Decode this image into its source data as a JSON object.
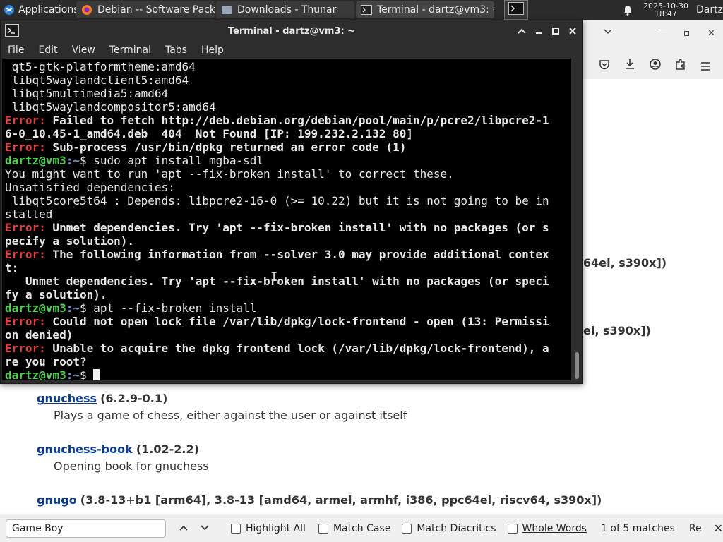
{
  "taskbar": {
    "apps_label": "Applications",
    "tasks": [
      {
        "label": "Debian -- Software Pack..."
      },
      {
        "label": "Downloads - Thunar"
      },
      {
        "label": "Terminal - dartz@vm3: ~"
      }
    ],
    "date": "2025-10-30",
    "time": "18:47",
    "user": "Dartz"
  },
  "terminal": {
    "title": "Terminal - dartz@vm3: ~",
    "menu": [
      "File",
      "Edit",
      "View",
      "Terminal",
      "Tabs",
      "Help"
    ],
    "prompt_user": "dartz@vm3",
    "prompt_path": ":~",
    "prompt_sign": "$",
    "error_tag": "Error:",
    "lines": {
      "l1": " qt5-gtk-platformtheme:amd64",
      "l2": " libqt5waylandclient5:amd64",
      "l3": " libqt5multimedia5:amd64",
      "l4": " libqt5waylandcompositor5:amd64",
      "l5": " Failed to fetch http://deb.debian.org/debian/pool/main/p/pcre2/libpcre2-1",
      "l6": "6-0_10.45-1_amd64.deb  404  Not Found [IP: 199.232.2.132 80]",
      "l7": " Sub-process /usr/bin/dpkg returned an error code (1)",
      "l8": " sudo apt install mgba-sdl",
      "l9": "You might want to run 'apt --fix-broken install' to correct these.",
      "l10": "Unsatisfied dependencies:",
      "l11": " libqt5core5t64 : Depends: libpcre2-16-0 (>= 10.22) but it is not going to be in",
      "l12": "stalled",
      "l13": " Unmet dependencies. Try 'apt --fix-broken install' with no packages (or s",
      "l14": "pecify a solution).",
      "l15": " The following information from --solver 3.0 may provide additional contex",
      "l16": "t:",
      "l17": "   Unmet dependencies. Try 'apt --fix-broken install' with no packages (or speci",
      "l18": "fy a solution).",
      "l19": " apt --fix-broken install",
      "l20": " Could not open lock file /var/lib/dpkg/lock-frontend - open (13: Permissi",
      "l21": "on denied)",
      "l22": " Unable to acquire the dpkg frontend lock (/var/lib/dpkg/lock-frontend), a",
      "l23": "re you root?",
      "l24": " "
    }
  },
  "browser": {
    "frag1": "64el, s390x])",
    "frag2": "el, s390x])",
    "packages": [
      {
        "name": "gnuchess",
        "version": "(6.2.9-0.1)",
        "desc": "Plays a game of chess, either against the user or against itself"
      },
      {
        "name": "gnuchess-book",
        "version": "(1.02-2.2)",
        "desc": "Opening book for gnuchess"
      },
      {
        "name": "gnugo",
        "version": "(3.8-13+b1 [arm64], 3.8-13 [amd64, armel, armhf, i386, ppc64el, riscv64, s390x])",
        "desc": ""
      }
    ]
  },
  "findbar": {
    "value": "Game Boy",
    "highlight_all": "Highlight All",
    "match_case": "Match Case",
    "match_diacritics": "Match Diacritics",
    "whole_words": "Whole Words",
    "matches": "1 of 5 matches",
    "reached": "Re"
  }
}
